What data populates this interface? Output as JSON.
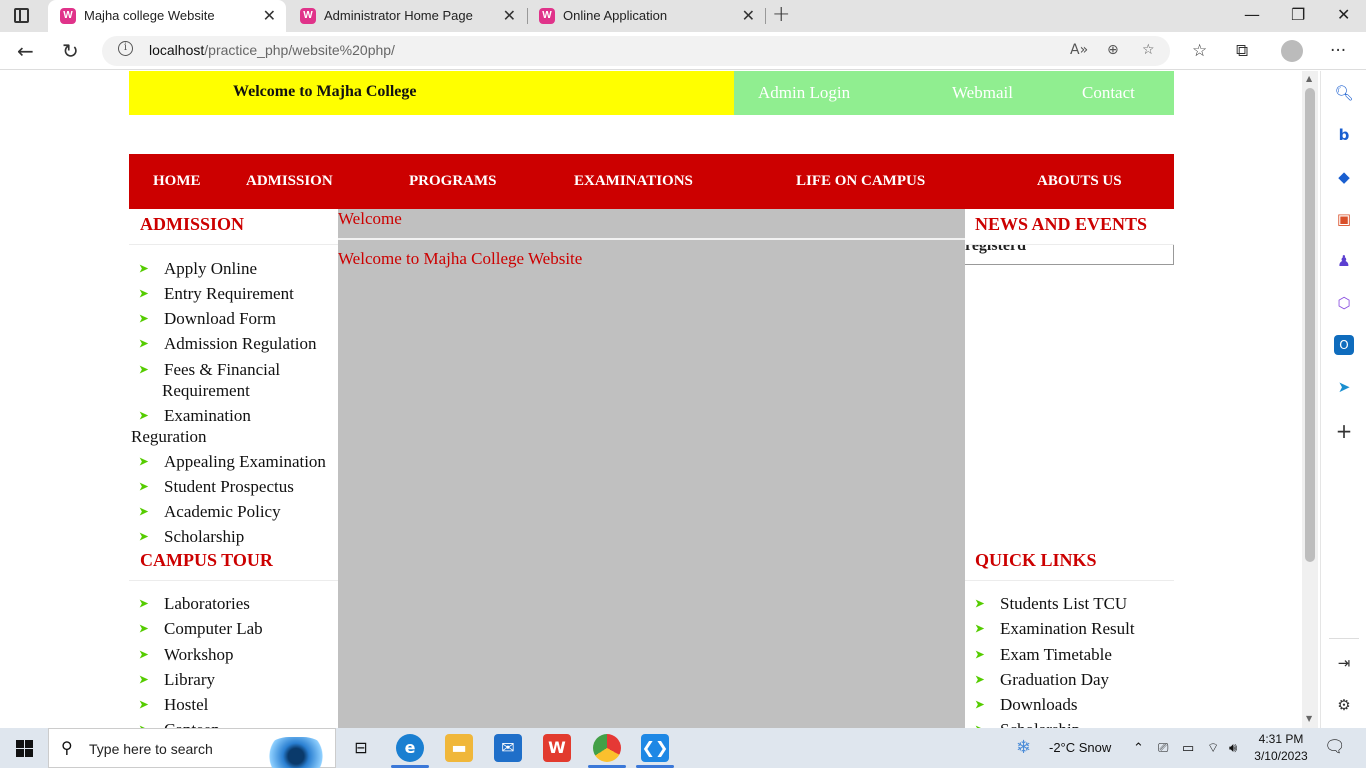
{
  "browser": {
    "tabs": [
      {
        "title": "Majha college Website",
        "active": true
      },
      {
        "title": "Administrator Home Page",
        "active": false
      },
      {
        "title": "Online Application",
        "active": false
      }
    ],
    "url_host": "localhost",
    "url_path": "/practice_php/website%20php/"
  },
  "site": {
    "welcome_banner": "Welcome to Majha College",
    "top_links": [
      "Admin Login",
      "Webmail",
      "Contact"
    ],
    "main_nav": [
      "HOME",
      "ADMISSION",
      "PROGRAMS",
      "EXAMINATIONS",
      "LIFE ON CAMPUS",
      "ABOUTS US"
    ],
    "admission": {
      "heading": "ADMISSION",
      "items": [
        "Apply Online",
        "Entry Requirement",
        "Download Form",
        "Admission Regulation",
        "Fees & Financial",
        "Requirement",
        "Examination",
        "Reguration",
        "Appealing Examination",
        "Student Prospectus",
        "Academic Policy",
        "Scholarship"
      ]
    },
    "campus_tour": {
      "heading": "CAMPUS TOUR",
      "items": [
        "Laboratories",
        "Computer Lab",
        "Workshop",
        "Library",
        "Hostel",
        "Canteen"
      ]
    },
    "center": {
      "title": "Welcome",
      "message": "Welcome to Majha College Website"
    },
    "news": {
      "heading": "NEWS AND EVENTS",
      "ticker": "registerd"
    },
    "quick_links": {
      "heading": "QUICK LINKS",
      "items": [
        "Students List TCU",
        "Examination Result",
        "Exam Timetable",
        "Graduation Day",
        "Downloads",
        "Scholarship"
      ]
    }
  },
  "taskbar": {
    "search_placeholder": "Type here to search",
    "weather": "-2°C  Snow",
    "time": "4:31 PM",
    "date": "3/10/2023"
  },
  "colors": {
    "banner_yellow": "#ffff00",
    "banner_green": "#90ee90",
    "nav_red": "#cc0000",
    "content_gray": "#c0c0c0",
    "bullet_green": "#55cc00"
  }
}
